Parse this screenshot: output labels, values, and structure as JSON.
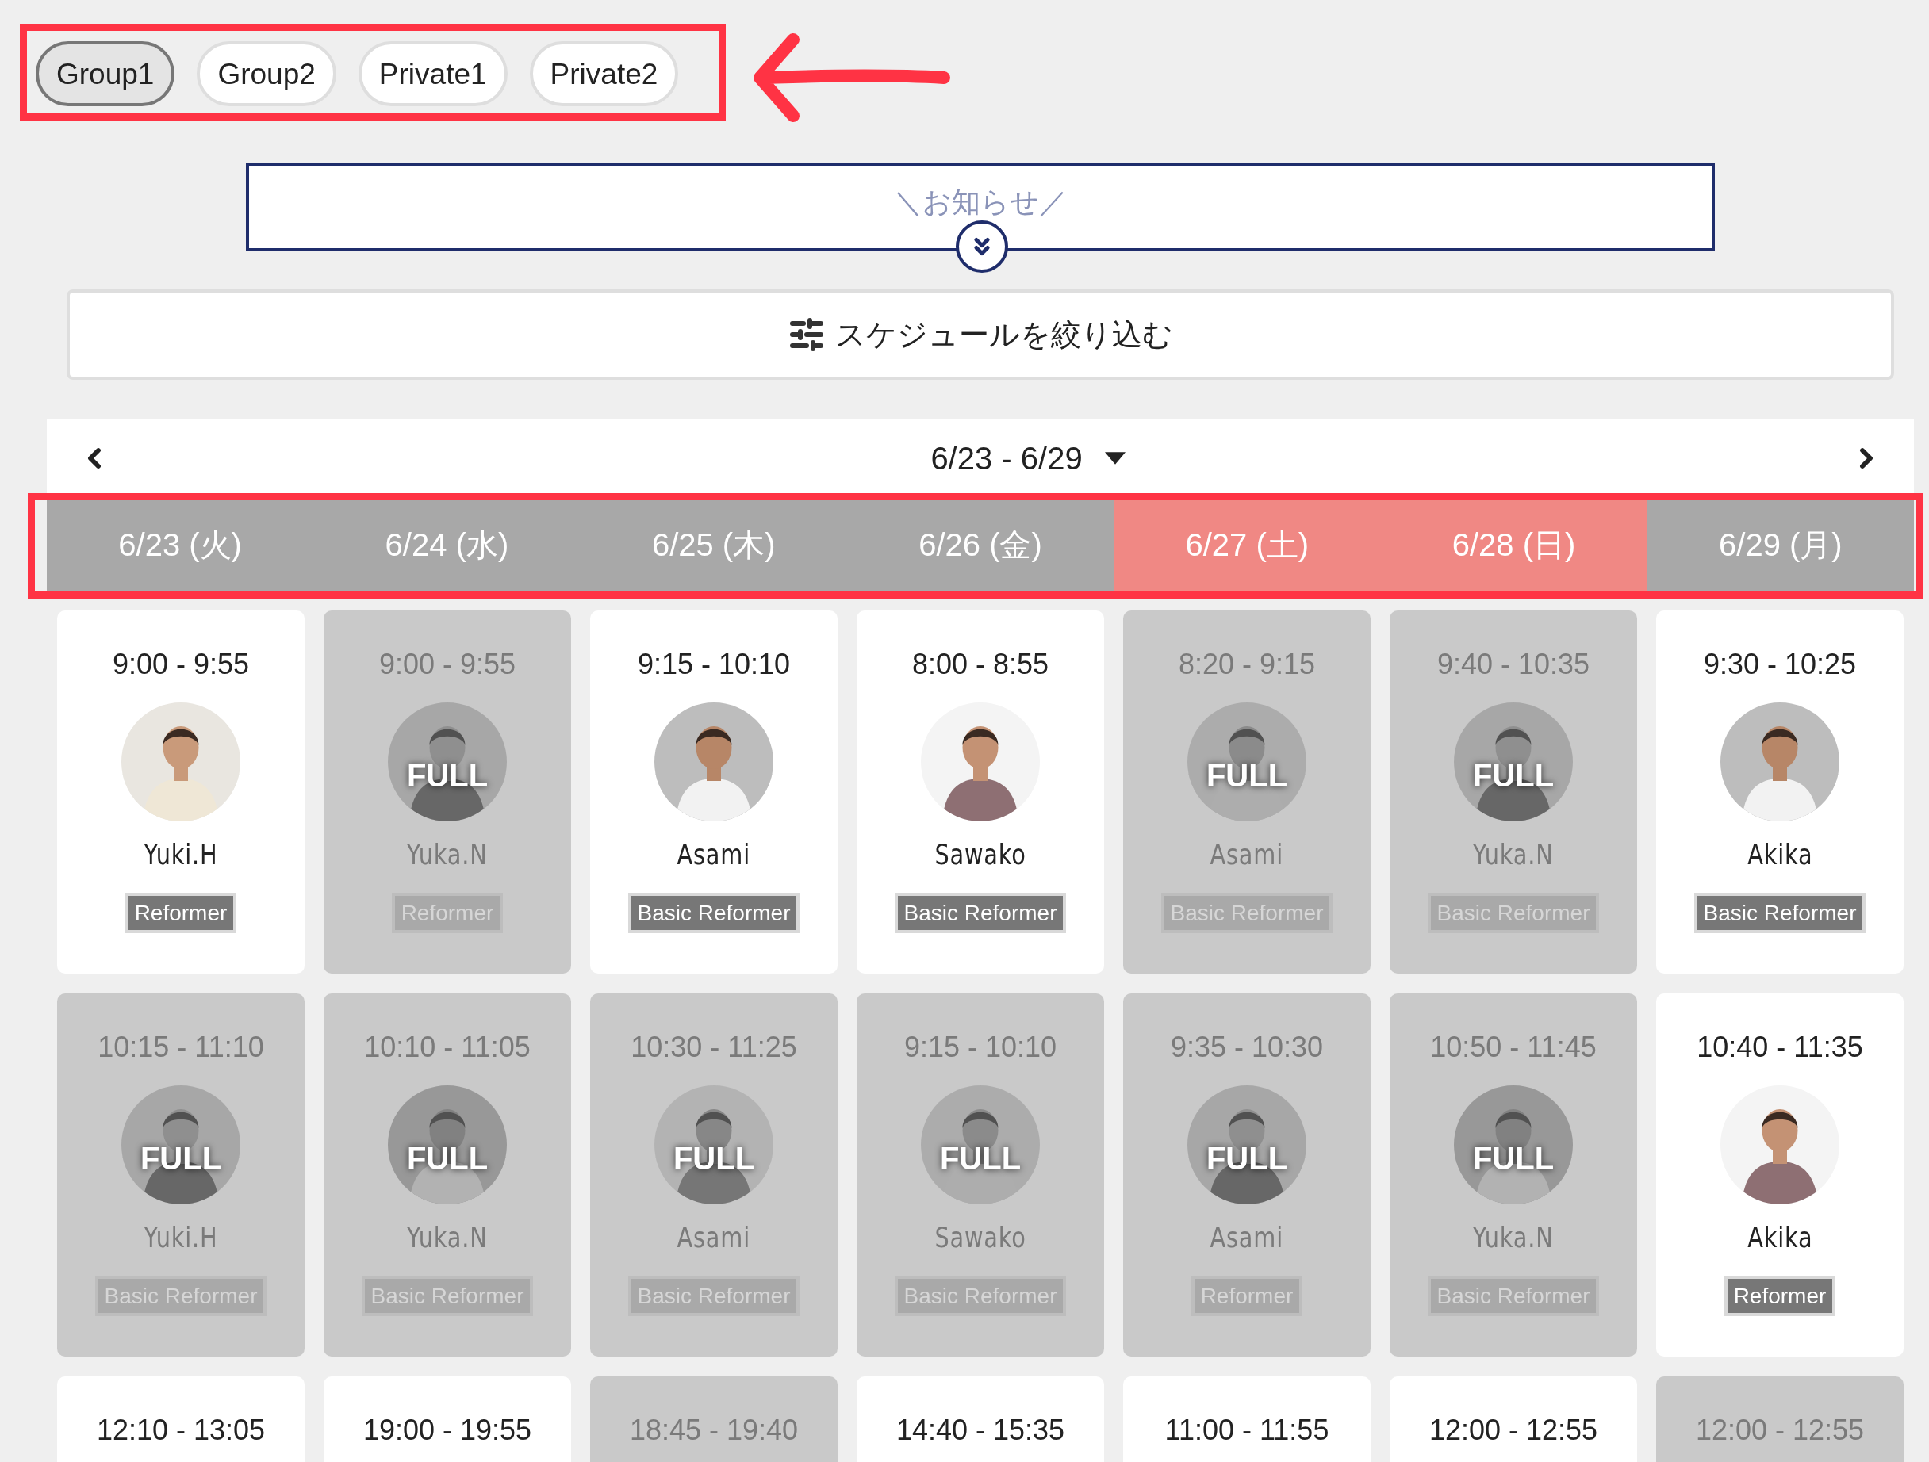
{
  "plan_tabs": [
    {
      "label": "Group1",
      "selected": true
    },
    {
      "label": "Group2",
      "selected": false
    },
    {
      "label": "Private1",
      "selected": false
    },
    {
      "label": "Private2",
      "selected": false
    }
  ],
  "notice": {
    "title": "＼お知らせ／"
  },
  "filter": {
    "label": "スケジュールを絞り込む"
  },
  "week": {
    "range": "6/23 - 6/29"
  },
  "days": [
    {
      "label": "6/23 (火)",
      "color": "#a8a8a8"
    },
    {
      "label": "6/24 (水)",
      "color": "#a8a8a8"
    },
    {
      "label": "6/25 (木)",
      "color": "#a8a8a8"
    },
    {
      "label": "6/26 (金)",
      "color": "#a8a8a8"
    },
    {
      "label": "6/27 (土)",
      "color": "#f08884"
    },
    {
      "label": "6/28 (日)",
      "color": "#f08884"
    },
    {
      "label": "6/29 (月)",
      "color": "#a8a8a8"
    }
  ],
  "lessons": [
    [
      {
        "time": "9:00 - 9:55",
        "instructor": "Yuki.H",
        "class": "Reformer",
        "full": false
      },
      {
        "time": "9:00 - 9:55",
        "instructor": "Yuka.N",
        "class": "Reformer",
        "full": true,
        "full_label": "FULL"
      },
      {
        "time": "9:15 - 10:10",
        "instructor": "Asami",
        "class": "Basic Reformer",
        "full": false
      },
      {
        "time": "8:00 - 8:55",
        "instructor": "Sawako",
        "class": "Basic Reformer",
        "full": false
      },
      {
        "time": "8:20 - 9:15",
        "instructor": "Asami",
        "class": "Basic Reformer",
        "full": true,
        "full_label": "FULL"
      },
      {
        "time": "9:40 - 10:35",
        "instructor": "Yuka.N",
        "class": "Basic Reformer",
        "full": true,
        "full_label": "FULL"
      },
      {
        "time": "9:30 - 10:25",
        "instructor": "Akika",
        "class": "Basic Reformer",
        "full": false
      }
    ],
    [
      {
        "time": "10:15 - 11:10",
        "instructor": "Yuki.H",
        "class": "Basic Reformer",
        "full": true,
        "full_label": "FULL"
      },
      {
        "time": "10:10 - 11:05",
        "instructor": "Yuka.N",
        "class": "Basic Reformer",
        "full": true,
        "full_label": "FULL"
      },
      {
        "time": "10:30 - 11:25",
        "instructor": "Asami",
        "class": "Basic Reformer",
        "full": true,
        "full_label": "FULL"
      },
      {
        "time": "9:15 - 10:10",
        "instructor": "Sawako",
        "class": "Basic Reformer",
        "full": true,
        "full_label": "FULL"
      },
      {
        "time": "9:35 - 10:30",
        "instructor": "Asami",
        "class": "Reformer",
        "full": true,
        "full_label": "FULL"
      },
      {
        "time": "10:50 - 11:45",
        "instructor": "Yuka.N",
        "class": "Basic Reformer",
        "full": true,
        "full_label": "FULL"
      },
      {
        "time": "10:40 - 11:35",
        "instructor": "Akika",
        "class": "Reformer",
        "full": false
      }
    ],
    [
      {
        "time": "12:10 - 13:05",
        "full": false
      },
      {
        "time": "19:00 - 19:55",
        "full": false
      },
      {
        "time": "18:45 - 19:40",
        "full": true
      },
      {
        "time": "14:40 - 15:35",
        "full": false
      },
      {
        "time": "11:00 - 11:55",
        "full": false
      },
      {
        "time": "12:00 - 12:55",
        "full": false
      },
      {
        "time": "12:00 - 12:55",
        "full": true
      }
    ]
  ]
}
